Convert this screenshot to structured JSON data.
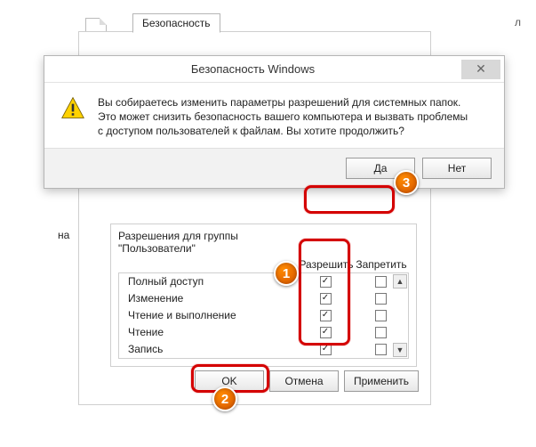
{
  "tab": {
    "security": "Безопасность"
  },
  "stray_letter": "л",
  "dialog": {
    "title": "Безопасность Windows",
    "message": "Вы собираетесь изменить параметры разрешений для системных папок. Это может снизить безопасность вашего компьютера и вызвать проблемы с доступом пользователей к файлам. Вы хотите продолжить?",
    "yes": "Да",
    "no": "Нет",
    "close": "✕"
  },
  "perm": {
    "side_label": "на",
    "title": "Разрешения для группы \"Пользователи\"",
    "allow_header": "Разрешить",
    "deny_header": "Запретить",
    "rows": [
      {
        "name": "Полный доступ",
        "allow": true,
        "deny": false
      },
      {
        "name": "Изменение",
        "allow": true,
        "deny": false
      },
      {
        "name": "Чтение и выполнение",
        "allow": true,
        "deny": false
      },
      {
        "name": "Чтение",
        "allow": true,
        "deny": false
      },
      {
        "name": "Запись",
        "allow": true,
        "deny": false
      }
    ]
  },
  "buttons": {
    "ok": "OK",
    "cancel": "Отмена",
    "apply": "Применить"
  },
  "annotations": {
    "n1": "1",
    "n2": "2",
    "n3": "3"
  }
}
